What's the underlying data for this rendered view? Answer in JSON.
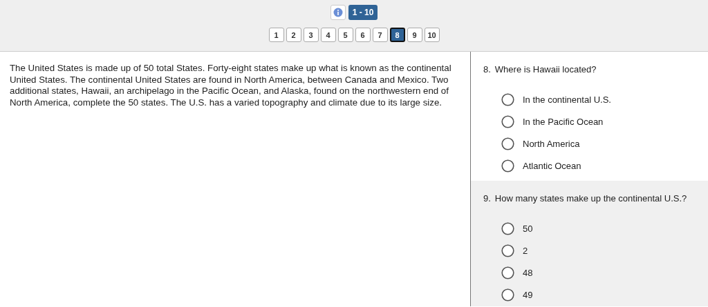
{
  "header": {
    "range_label": "1 - 10",
    "pages": [
      {
        "label": "1",
        "selected": false
      },
      {
        "label": "2",
        "selected": false
      },
      {
        "label": "3",
        "selected": false
      },
      {
        "label": "4",
        "selected": false
      },
      {
        "label": "5",
        "selected": false
      },
      {
        "label": "6",
        "selected": false
      },
      {
        "label": "7",
        "selected": false
      },
      {
        "label": "8",
        "selected": true
      },
      {
        "label": "9",
        "selected": false
      },
      {
        "label": "10",
        "selected": false
      }
    ]
  },
  "passage": "The United States is made up of 50 total States. Forty-eight states make up what is known as the continental United States. The continental United States are found in North America, between Canada and Mexico. Two additional states, Hawaii, an archipelago in the Pacific Ocean, and Alaska, found on the northwestern end of North America, complete the 50 states. The U.S. has a varied topography and climate due to its large size.",
  "questions": [
    {
      "number": "8.",
      "text": "Where is Hawaii located?",
      "highlighted": false,
      "options": [
        {
          "label": "In the continental U.S.",
          "selected": false
        },
        {
          "label": "In the Pacific Ocean",
          "selected": false
        },
        {
          "label": "North America",
          "selected": false
        },
        {
          "label": "Atlantic Ocean",
          "selected": false
        }
      ]
    },
    {
      "number": "9.",
      "text": "How many states make up the continental U.S.?",
      "highlighted": true,
      "options": [
        {
          "label": "50",
          "selected": false
        },
        {
          "label": "2",
          "selected": false
        },
        {
          "label": "48",
          "selected": false
        },
        {
          "label": "49",
          "selected": false
        }
      ]
    }
  ]
}
